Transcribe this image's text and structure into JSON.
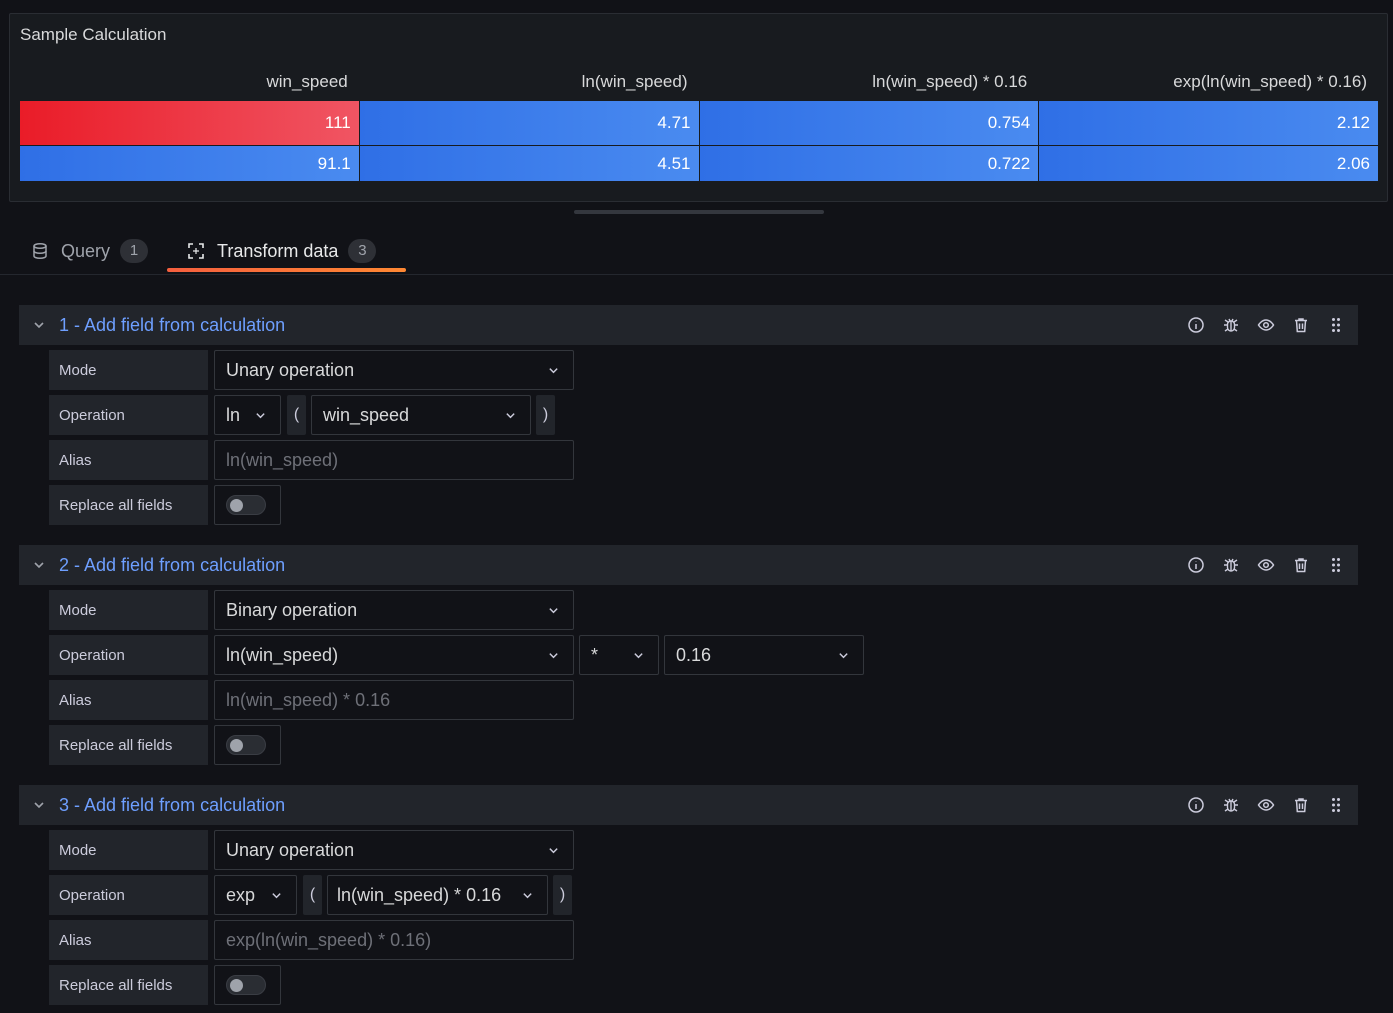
{
  "panel": {
    "title": "Sample Calculation",
    "columns": [
      "win_speed",
      "ln(win_speed)",
      "ln(win_speed) * 0.16",
      "exp(ln(win_speed) * 0.16)"
    ],
    "rows": [
      [
        "111",
        "4.71",
        "0.754",
        "2.12"
      ],
      [
        "91.1",
        "4.51",
        "0.722",
        "2.06"
      ]
    ]
  },
  "tabs": {
    "query_label": "Query",
    "query_count": "1",
    "transform_label": "Transform data",
    "transform_count": "3"
  },
  "labels": {
    "mode": "Mode",
    "operation": "Operation",
    "alias": "Alias",
    "replace": "Replace all fields",
    "open_paren": "(",
    "close_paren": ")"
  },
  "transformations": [
    {
      "title": "1 - Add field from calculation",
      "mode": "Unary operation",
      "op_fn": "ln",
      "op_field": "win_speed",
      "alias_placeholder": "ln(win_speed)"
    },
    {
      "title": "2 - Add field from calculation",
      "mode": "Binary operation",
      "op_left": "ln(win_speed)",
      "op_operator": "*",
      "op_right": "0.16",
      "alias_placeholder": "ln(win_speed) * 0.16"
    },
    {
      "title": "3 - Add field from calculation",
      "mode": "Unary operation",
      "op_fn": "exp",
      "op_field": "ln(win_speed) * 0.16",
      "alias_placeholder": "exp(ln(win_speed) * 0.16)"
    }
  ]
}
